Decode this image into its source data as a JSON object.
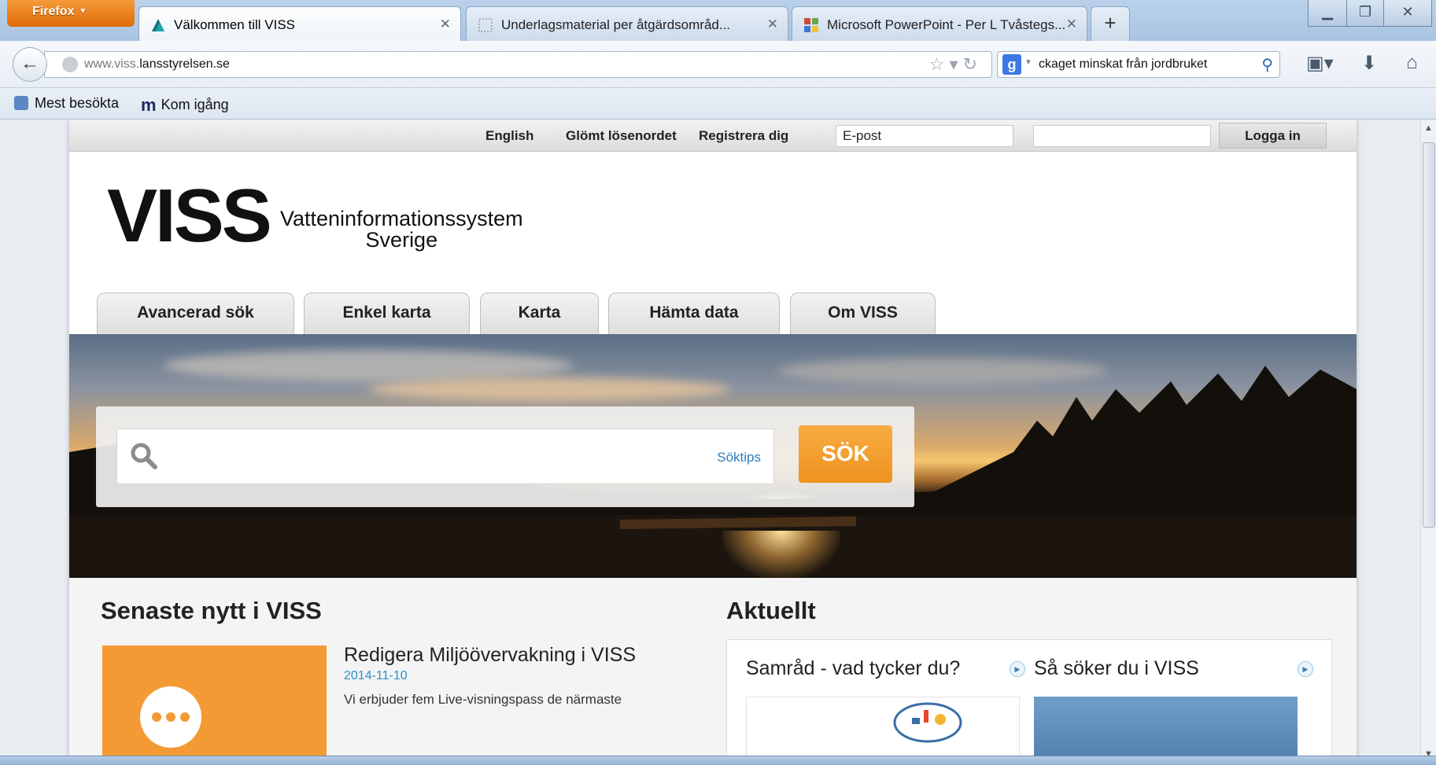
{
  "browser": {
    "menu_button": "Firefox",
    "tabs": [
      {
        "title": "Välkommen till VISS",
        "active": true
      },
      {
        "title": "Underlagsmaterial per åtgärdsområd...",
        "active": false
      },
      {
        "title": "Microsoft PowerPoint - Per L Tvåstegs...",
        "active": false
      }
    ],
    "new_tab": "+",
    "url_prefix": "www.viss.",
    "url_domain": "lansstyrelsen.se",
    "search_text": "ckaget minskat från jordbruket",
    "bookmarks": [
      {
        "label": "Mest besökta"
      },
      {
        "label": "Kom igång"
      }
    ]
  },
  "site": {
    "top_links": {
      "english": "English",
      "forgot": "Glömt lösenordet",
      "register": "Registrera dig"
    },
    "email_placeholder": "E-post",
    "login_label": "Logga in",
    "logo_main": "VISS",
    "logo_sub_line1": "Vatteninformationssystem",
    "logo_sub_line2": "Sverige",
    "menu_tabs": [
      "Avancerad sök",
      "Enkel karta",
      "Karta",
      "Hämta data",
      "Om VISS"
    ],
    "search": {
      "tips": "Söktips",
      "button": "SÖK"
    },
    "news": {
      "heading": "Senaste nytt i VISS",
      "title": "Redigera Miljöövervakning i VISS",
      "date": "2014-11-10",
      "text": "Vi erbjuder fem Live-visningspass de närmaste"
    },
    "current": {
      "heading": "Aktuellt",
      "card1": "Samråd - vad tycker du?",
      "card2": "Så söker du i VISS"
    }
  },
  "colors": {
    "accent_orange": "#f39a35",
    "link_blue": "#2e8fc7",
    "firefox_orange": "#e06a07"
  }
}
